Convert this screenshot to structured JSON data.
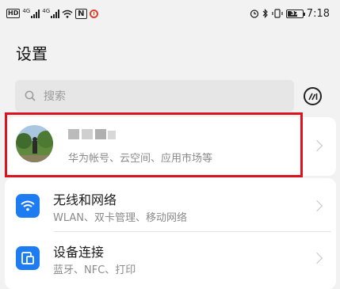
{
  "status_bar": {
    "network_hd": "HD",
    "network_1": "4G",
    "network_2": "4G",
    "nfc": "N",
    "battery": "37",
    "time": "7:18"
  },
  "header": {
    "title": "设置"
  },
  "search": {
    "placeholder": "搜索"
  },
  "account": {
    "subtitle": "华为帐号、云空间、应用市场等"
  },
  "settings_items": [
    {
      "title": "无线和网络",
      "subtitle": "WLAN、双卡管理、移动网络",
      "icon": "wifi-icon"
    },
    {
      "title": "设备连接",
      "subtitle": "蓝牙、NFC、打印",
      "icon": "device-connection-icon"
    }
  ],
  "colors": {
    "accent": "#1d7cf2",
    "highlight": "#d8141e",
    "background": "#f2f2f2"
  }
}
